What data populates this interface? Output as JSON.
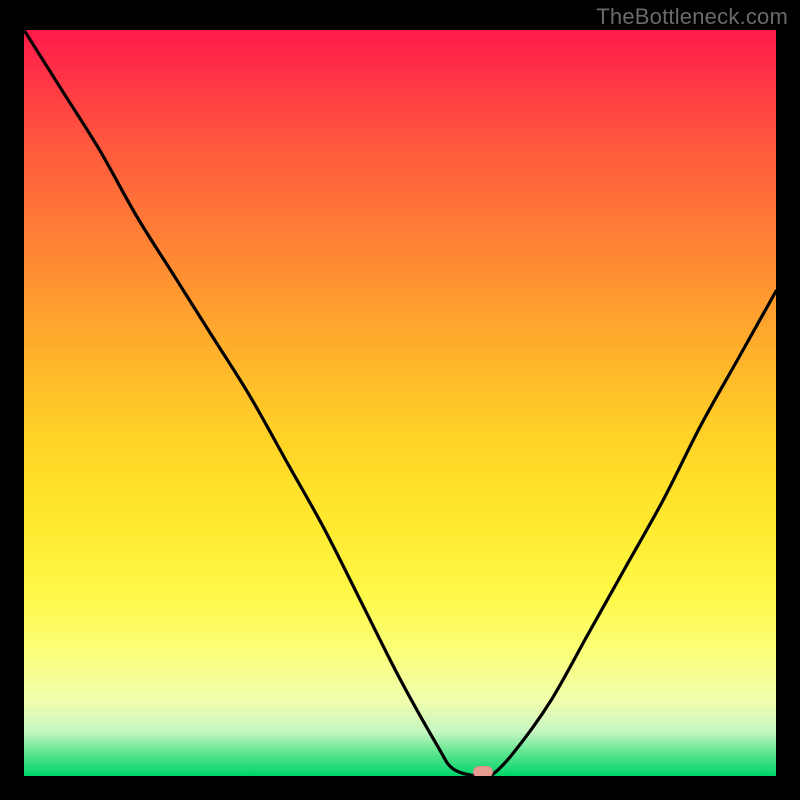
{
  "watermark": "TheBottleneck.com",
  "colors": {
    "background": "#000000",
    "curve": "#000000",
    "marker": "#e69a92",
    "gradient_top": "#ff1a4b",
    "gradient_bottom": "#00d46b"
  },
  "chart_data": {
    "type": "line",
    "title": "",
    "xlabel": "",
    "ylabel": "",
    "xlim": [
      0,
      100
    ],
    "ylim": [
      0,
      100
    ],
    "x": [
      0,
      5,
      10,
      15,
      20,
      25,
      30,
      35,
      40,
      45,
      50,
      55,
      57,
      60,
      62,
      65,
      70,
      75,
      80,
      85,
      90,
      95,
      100
    ],
    "values": [
      100,
      92,
      84,
      75,
      67,
      59,
      51,
      42,
      33,
      23,
      13,
      4,
      1,
      0,
      0,
      3,
      10,
      19,
      28,
      37,
      47,
      56,
      65
    ],
    "minimum_x": 61,
    "minimum_y": 0,
    "series": [
      {
        "name": "bottleneck-curve",
        "x": [
          0,
          5,
          10,
          15,
          20,
          25,
          30,
          35,
          40,
          45,
          50,
          55,
          57,
          60,
          62,
          65,
          70,
          75,
          80,
          85,
          90,
          95,
          100
        ],
        "values": [
          100,
          92,
          84,
          75,
          67,
          59,
          51,
          42,
          33,
          23,
          13,
          4,
          1,
          0,
          0,
          3,
          10,
          19,
          28,
          37,
          47,
          56,
          65
        ]
      }
    ],
    "annotations": [
      {
        "type": "marker",
        "shape": "pill",
        "x": 61,
        "y": 0,
        "color": "#e69a92"
      }
    ]
  }
}
